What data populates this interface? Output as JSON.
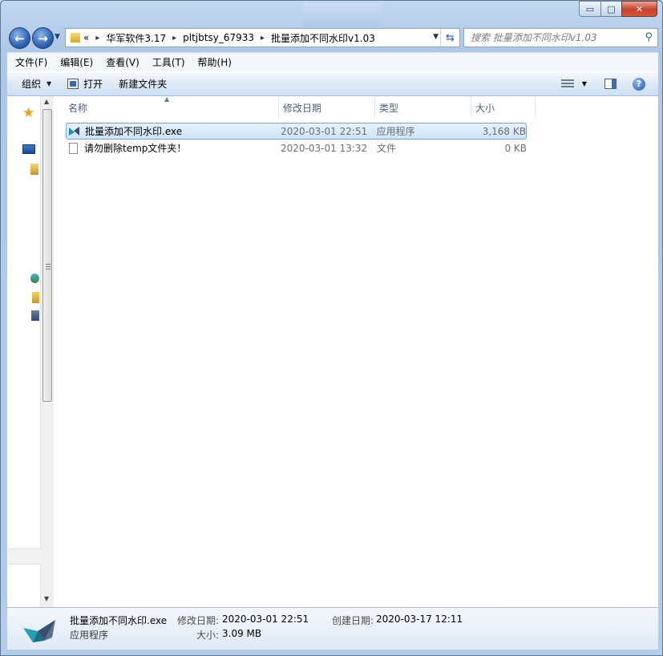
{
  "titlebar": {
    "minimize_glyph": "▭",
    "maximize_glyph": "□",
    "close_glyph": "✕"
  },
  "address": {
    "overflow_glyph": "«",
    "crumbs": [
      "华军软件3.17",
      "pltjbtsy_67933",
      "批量添加不同水印v1.03"
    ]
  },
  "search": {
    "placeholder": "搜索 批量添加不同水印v1.03"
  },
  "menu": {
    "file": "文件(F)",
    "edit": "编辑(E)",
    "view": "查看(V)",
    "tools": "工具(T)",
    "help": "帮助(H)"
  },
  "toolbar": {
    "organize": "组织",
    "open": "打开",
    "new_folder": "新建文件夹"
  },
  "columns": {
    "name": "名称",
    "modified": "修改日期",
    "type": "类型",
    "size": "大小"
  },
  "files": [
    {
      "name": "批量添加不同水印.exe",
      "modified": "2020-03-01 22:51",
      "type": "应用程序",
      "size": "3,168 KB",
      "selected": true,
      "icon": "crane-app-icon"
    },
    {
      "name": "请勿删除temp文件夹！",
      "modified": "2020-03-01 13:32",
      "type": "文件",
      "size": "0 KB",
      "selected": false,
      "icon": "blank-file-icon"
    }
  ],
  "details": {
    "name": "批量添加不同水印.exe",
    "type": "应用程序",
    "modified_label": "修改日期:",
    "modified_value": "2020-03-01 22:51",
    "created_label": "创建日期:",
    "created_value": "2020-03-17 12:11",
    "size_label": "大小:",
    "size_value": "3.09 MB"
  },
  "colors": {
    "accent": "#2f64b4",
    "selection": "#cfe4fa",
    "close": "#c7432b"
  }
}
